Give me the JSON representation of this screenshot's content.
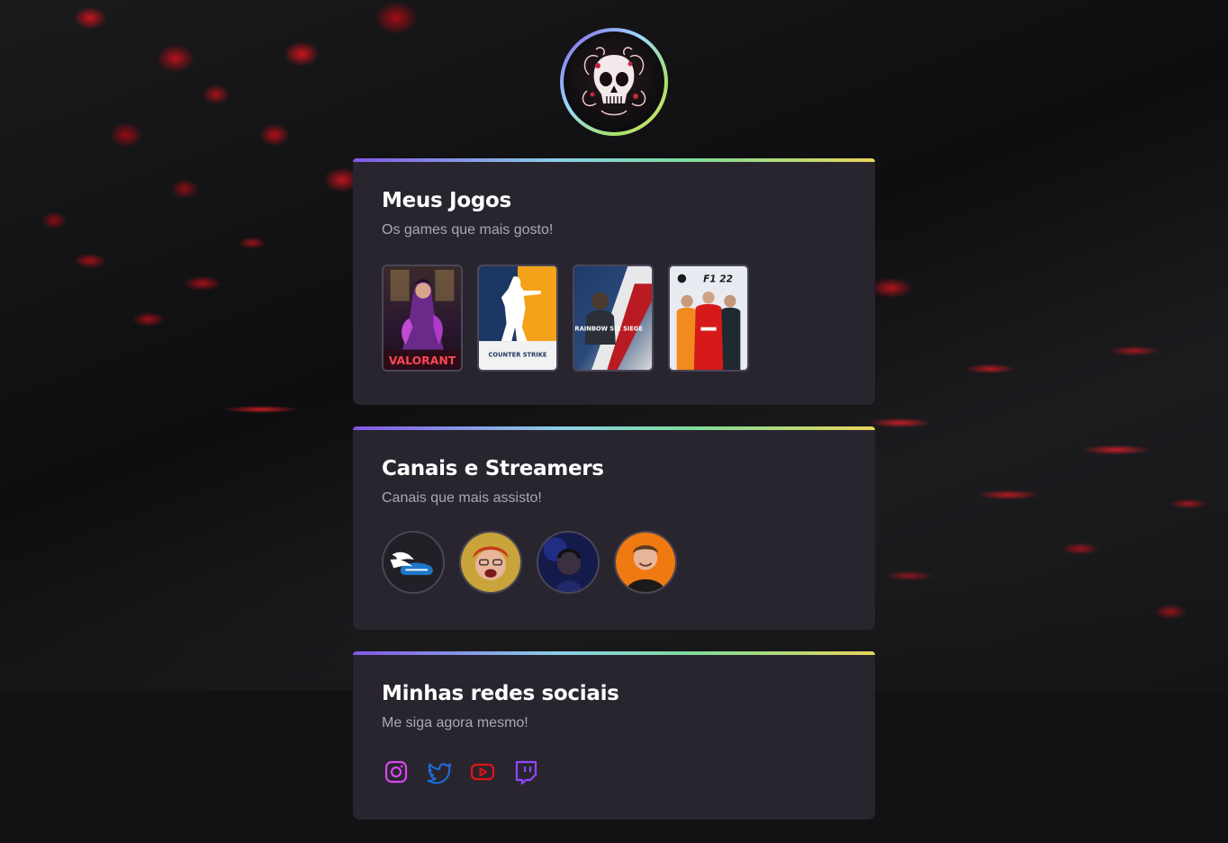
{
  "profile": {
    "avatar_icon": "skull-icon",
    "ring_colors": [
      "#8257e5",
      "#9bd9ff",
      "#a8e06b",
      "#e7e36a"
    ]
  },
  "games_card": {
    "title": "Meus Jogos",
    "subtitle": "Os games que mais gosto!",
    "games": [
      {
        "name": "VALORANT",
        "logo_text": "VALORANT"
      },
      {
        "name": "Counter-Strike",
        "logo_text": "COUNTER STRIKE"
      },
      {
        "name": "Rainbow Six Siege",
        "logo_text": "RAINBOW SIX SIEGE"
      },
      {
        "name": "F1 22",
        "logo_text": "F1 22"
      }
    ]
  },
  "streams_card": {
    "title": "Canais e Streamers",
    "subtitle": "Canais que mais assisto!",
    "streamers": [
      {
        "icon": "winged-shoe-icon"
      },
      {
        "icon": "streamer-avatar-2"
      },
      {
        "icon": "streamer-avatar-3"
      },
      {
        "icon": "streamer-avatar-4"
      }
    ]
  },
  "social_card": {
    "title": "Minhas redes sociais",
    "subtitle": "Me siga agora mesmo!",
    "links": [
      {
        "icon": "instagram-icon",
        "color": "#d946ef"
      },
      {
        "icon": "twitter-icon",
        "color": "#1d6fe0"
      },
      {
        "icon": "youtube-icon",
        "color": "#e01414"
      },
      {
        "icon": "twitch-icon",
        "color": "#9146ff"
      }
    ]
  },
  "colors": {
    "page_bg": "#121214",
    "card_bg": "#29252f",
    "title": "#ffffff",
    "subtitle": "#a8a8b3"
  }
}
